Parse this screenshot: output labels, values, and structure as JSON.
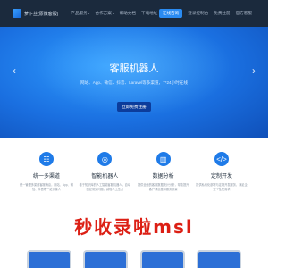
{
  "nav": {
    "logo_text": "萝卜丝(原微客服)",
    "links": [
      "产品服务",
      "合作方案",
      "帮助文档",
      "下载地址"
    ],
    "right_links": [
      "登录控制台",
      "免费注册",
      "官方客服"
    ],
    "cta_label": "在线咨询"
  },
  "hero": {
    "title": "客服机器人",
    "subtitle": "网站、App、微信、抖音、Laravel等多渠道，7*24小时在线",
    "button_label": "立即免费注册"
  },
  "features": [
    {
      "icon": "users-icon",
      "title": "统一多渠道",
      "desc": "统一管理多渠道客服消息，网站、App、微信、抖音等一站式接入"
    },
    {
      "icon": "robot-icon",
      "title": "智能机器人",
      "desc": "基于知识库的人工智能客服机器人，自动回复常见问题，减轻人工压力"
    },
    {
      "icon": "chart-icon",
      "title": "数据分析",
      "desc": "提供全面的客服数据统计分析，帮助提升客户满意度和服务质量"
    },
    {
      "icon": "code-icon",
      "title": "定制开发",
      "desc": "提供私有化部署与定制开发服务，满足企业个性化需求"
    }
  ],
  "watermark": "秒收录啦msl",
  "colors": {
    "nav_bg": "#1b2a3d",
    "hero_blue": "#1a6fe0",
    "accent": "#1f7be8",
    "watermark_red": "#dc1f14"
  }
}
